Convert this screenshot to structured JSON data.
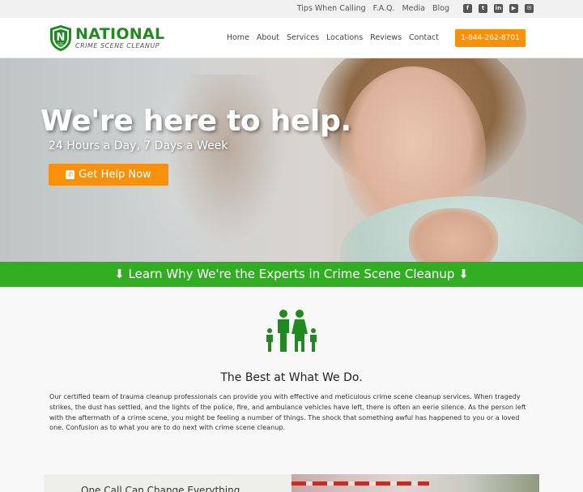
{
  "topbar": {
    "links": [
      "Tips When Calling",
      "F.A.Q.",
      "Media",
      "Blog"
    ],
    "social_icons": [
      "facebook-icon",
      "twitter-icon",
      "linkedin-icon",
      "youtube-icon",
      "email-icon"
    ]
  },
  "header": {
    "brand": "NATIONAL",
    "tagline": "CRIME SCENE CLEANUP",
    "logo_letter": "N",
    "logo_subletters": "CSC",
    "nav": [
      "Home",
      "About",
      "Services",
      "Locations",
      "Reviews",
      "Contact"
    ],
    "phone": "1-844-262-8701"
  },
  "hero": {
    "title": "We're here to help.",
    "subtitle": "24 Hours a Day, 7 Days a Week",
    "cta": "Get Help Now"
  },
  "learn_bar": {
    "text": "Learn Why We're the Experts in Crime Scene Cleanup"
  },
  "section": {
    "icon": "family-icon",
    "heading": "The Best at What We Do.",
    "body": "Our certified team of trauma cleanup professionals can provide you with effective and meticulous crime scene cleanup services. When tragedy strikes, the dust has settled, and the lights of the police, fire, and ambulance vehicles have left, there is often an eerie silence. As the person left with the aftermath of a crime scene, you might be feeling a number of things. The shock that something awful has happened to you or a loved one. Confusion as to what you are to do next with crime scene cleanup."
  },
  "bottom": {
    "left_text": "One Call Can Change Everything"
  },
  "colors": {
    "green": "#31ad22",
    "brand_green": "#1f8a1f",
    "orange": "#f7900a"
  }
}
